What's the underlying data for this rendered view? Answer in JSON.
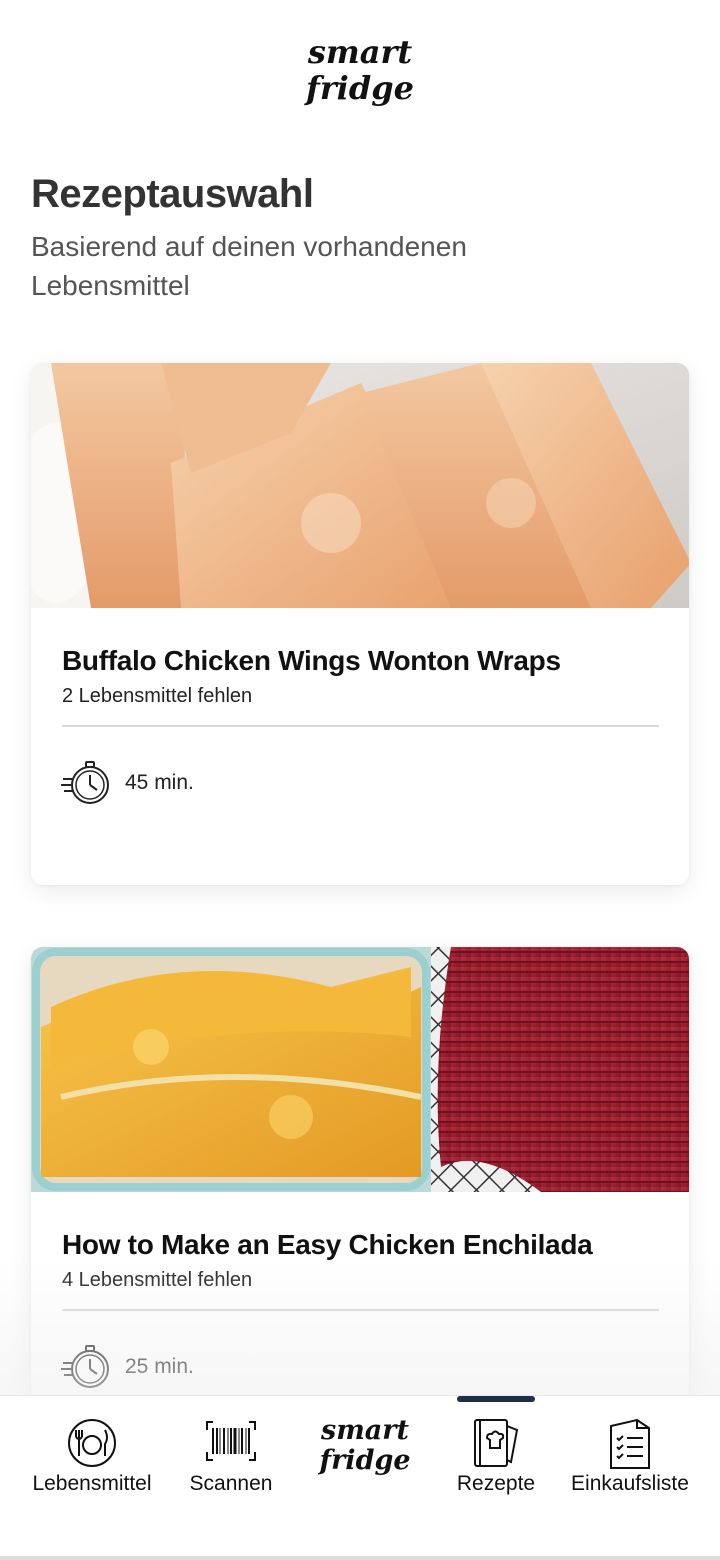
{
  "app": {
    "logo_line1": "smart",
    "logo_line2": "fridge"
  },
  "header": {
    "title": "Rezeptauswahl",
    "subtitle": "Basierend auf deinen vorhandenen Lebensmittel"
  },
  "recipes": [
    {
      "title": "Buffalo Chicken Wings Wonton Wraps",
      "missing": "2 Lebensmittel fehlen",
      "time": "45 min.",
      "time_icon": "stopwatch-icon"
    },
    {
      "title": "How to Make an Easy Chicken Enchilada",
      "missing": "4 Lebensmittel fehlen",
      "time": "25 min.",
      "time_icon": "stopwatch-icon"
    }
  ],
  "tabbar": {
    "items": [
      {
        "label": "Lebensmittel",
        "icon": "plate-cutlery-icon",
        "active": false
      },
      {
        "label": "Scannen",
        "icon": "barcode-icon",
        "active": false
      },
      {
        "logo_line1": "smart",
        "logo_line2": "fridge",
        "active": false
      },
      {
        "label": "Rezepte",
        "icon": "recipe-book-icon",
        "active": true
      },
      {
        "label": "Einkaufsliste",
        "icon": "checklist-icon",
        "active": false
      }
    ],
    "active_color": "#1f2d4a"
  }
}
